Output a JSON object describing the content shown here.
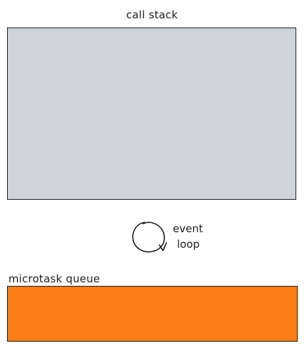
{
  "call_stack": {
    "label": "call stack",
    "fill_color": "#ced4dc"
  },
  "event_loop": {
    "line1": "event",
    "line2": "loop",
    "icon": "circular-arrow-icon"
  },
  "microtask_queue": {
    "label": "microtask queue",
    "fill_color": "#fd7e14"
  },
  "colors": {
    "stroke": "#1e1e1e",
    "background": "#ffffff"
  }
}
